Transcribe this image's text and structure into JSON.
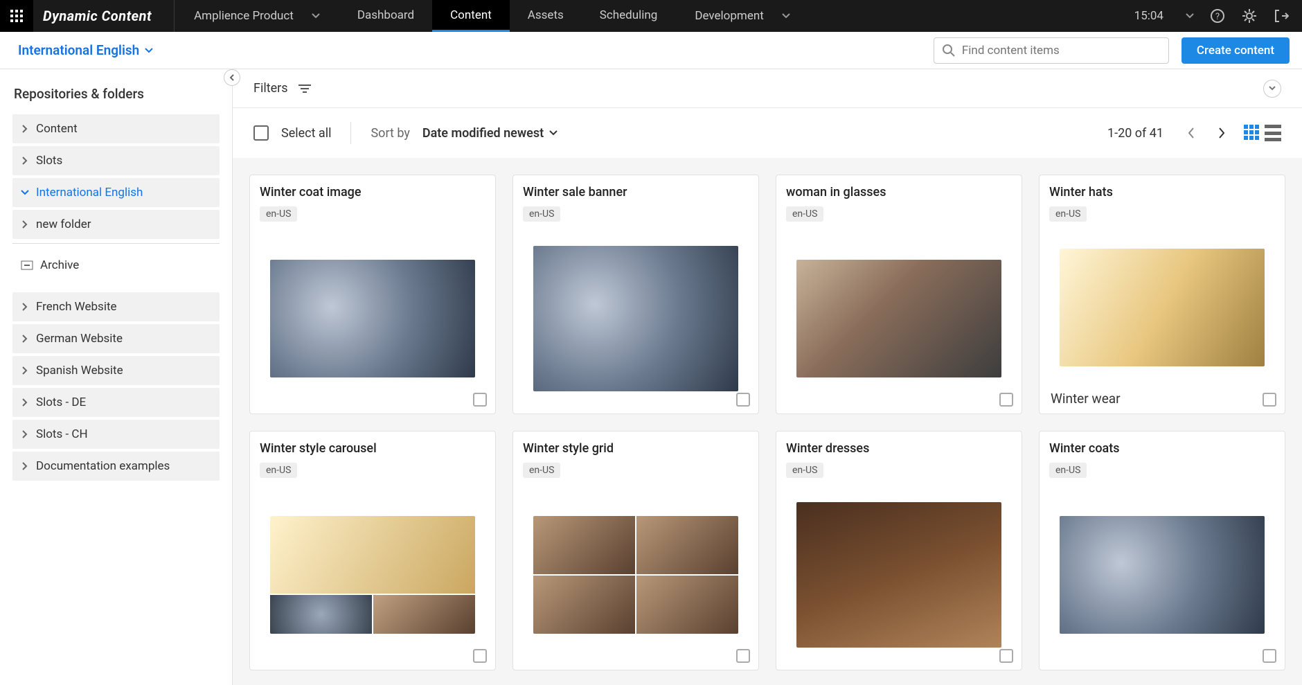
{
  "topbar": {
    "brand": "Dynamic Content",
    "product_label": "Amplience Product",
    "tabs": [
      "Dashboard",
      "Content",
      "Assets",
      "Scheduling"
    ],
    "active_tab": "Content",
    "dev_label": "Development",
    "time": "15:04"
  },
  "subheader": {
    "locale": "International English",
    "search_placeholder": "Find content items",
    "create_label": "Create content"
  },
  "sidebar": {
    "heading": "Repositories & folders",
    "items_top": [
      {
        "label": "Content"
      },
      {
        "label": "Slots"
      },
      {
        "label": "International English",
        "active": true,
        "expanded": true
      },
      {
        "label": "new folder"
      }
    ],
    "archive_label": "Archive",
    "items_bottom": [
      {
        "label": "French Website"
      },
      {
        "label": "German Website"
      },
      {
        "label": "Spanish Website"
      },
      {
        "label": "Slots - DE"
      },
      {
        "label": "Slots - CH"
      },
      {
        "label": "Documentation examples"
      }
    ]
  },
  "filters": {
    "label": "Filters"
  },
  "toolbar": {
    "select_all": "Select all",
    "sort_by_label": "Sort by",
    "sort_value": "Date modified newest",
    "page_count": "1-20 of 41"
  },
  "cards": [
    {
      "title": "Winter coat image",
      "locale": "en-US",
      "thumb": "snow"
    },
    {
      "title": "Winter sale banner",
      "locale": "en-US",
      "thumb": "snow",
      "tall": true
    },
    {
      "title": "woman in glasses",
      "locale": "en-US",
      "thumb": "plain"
    },
    {
      "title": "Winter hats",
      "locale": "en-US",
      "thumb": "bright",
      "caption": "Winter wear"
    },
    {
      "title": "Winter style carousel",
      "locale": "en-US",
      "thumb": "grid3"
    },
    {
      "title": "Winter style grid",
      "locale": "en-US",
      "thumb": "grid2"
    },
    {
      "title": "Winter dresses",
      "locale": "en-US",
      "thumb": "wood",
      "tall": true
    },
    {
      "title": "Winter coats",
      "locale": "en-US",
      "thumb": "snow"
    }
  ]
}
